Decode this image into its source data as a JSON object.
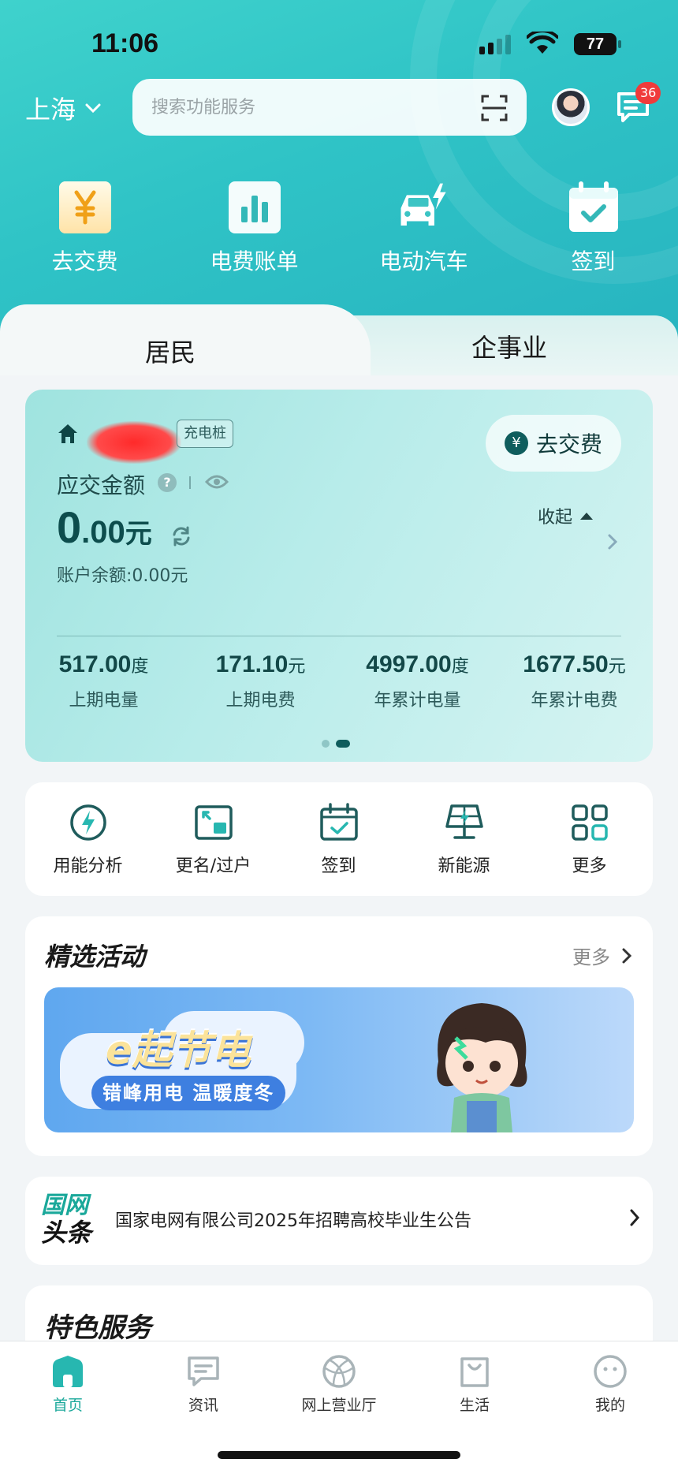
{
  "status": {
    "time": "11:06",
    "battery": "77"
  },
  "header": {
    "city": "上海",
    "search_placeholder": "搜索功能服务",
    "message_badge": "36"
  },
  "quick_actions": [
    {
      "label": "去交费",
      "icon": "yen-card-icon"
    },
    {
      "label": "电费账单",
      "icon": "bar-chart-icon"
    },
    {
      "label": "电动汽车",
      "icon": "electric-car-icon"
    },
    {
      "label": "签到",
      "icon": "calendar-check-icon"
    }
  ],
  "tabs": {
    "active": "居民",
    "inactive": "企事业"
  },
  "account": {
    "tag": "充电桩",
    "pay_button": "去交费",
    "due_label": "应交金额",
    "amount_int": "0",
    "amount_dec": ".00",
    "amount_unit": "元",
    "balance": "账户余额:0.00元",
    "collapse": "收起",
    "stats": [
      {
        "value": "517.00",
        "unit": "度",
        "label": "上期电量"
      },
      {
        "value": "171.10",
        "unit": "元",
        "label": "上期电费"
      },
      {
        "value": "4997.00",
        "unit": "度",
        "label": "年累计电量"
      },
      {
        "value": "1677.50",
        "unit": "元",
        "label": "年累计电费"
      }
    ],
    "page_indicator": {
      "total": 2,
      "current": 2
    }
  },
  "services": [
    {
      "label": "用能分析",
      "icon": "energy-analysis-icon"
    },
    {
      "label": "更名/过户",
      "icon": "transfer-icon"
    },
    {
      "label": "签到",
      "icon": "calendar-check-icon"
    },
    {
      "label": "新能源",
      "icon": "solar-panel-icon"
    },
    {
      "label": "更多",
      "icon": "grid-more-icon"
    }
  ],
  "activities": {
    "title": "精选活动",
    "more": "更多",
    "banner_title": "e起节电",
    "banner_subtitle": "错峰用电 温暖度冬"
  },
  "news": {
    "logo_line1": "国网",
    "logo_line2": "头条",
    "headline": "国家电网有限公司2025年招聘高校毕业生公告"
  },
  "featured": {
    "title": "特色服务"
  },
  "bottom_nav": [
    {
      "label": "首页",
      "active": true
    },
    {
      "label": "资讯",
      "active": false
    },
    {
      "label": "网上营业厅",
      "active": false
    },
    {
      "label": "生活",
      "active": false
    },
    {
      "label": "我的",
      "active": false
    }
  ],
  "colors": {
    "accent": "#1aa89a",
    "hero": "#2fc3c6",
    "badge": "#f03b3b"
  }
}
